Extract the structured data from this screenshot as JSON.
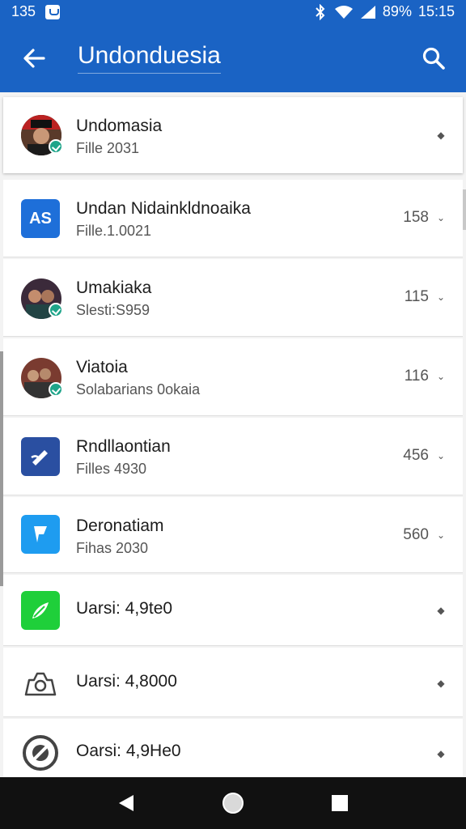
{
  "status_bar": {
    "left_text": "135",
    "battery": "89%",
    "time": "15:15"
  },
  "app_bar": {
    "title": "Undonduesia",
    "back_icon": "arrow-back-icon",
    "search_icon": "search-icon"
  },
  "items": [
    {
      "primary": "Undomasia",
      "secondary": "Fille 2031",
      "count": "",
      "icon": "avatar-person"
    },
    {
      "primary": "Undan Nidainkldnoaika",
      "secondary": "Fille.1.0021",
      "count": "158",
      "icon": "as-app-icon"
    },
    {
      "primary": "Umakiaka",
      "secondary": "Slesti:S959",
      "count": "115",
      "icon": "avatar-couple"
    },
    {
      "primary": "Viatoia",
      "secondary": "Solabarians 0okaia",
      "count": "116",
      "icon": "avatar-group"
    },
    {
      "primary": "Rndllaontian",
      "secondary": "Filles 4930",
      "count": "456",
      "icon": "edit-app-icon"
    },
    {
      "primary": "Deronatiam",
      "secondary": "Fihas 2030",
      "count": "560",
      "icon": "pin-app-icon"
    },
    {
      "primary": "Uarsi: 4,9te0",
      "secondary": "",
      "count": "",
      "icon": "leaf-app-icon"
    },
    {
      "primary": "Uarsi: 4,8000",
      "secondary": "",
      "count": "",
      "icon": "camera-icon"
    },
    {
      "primary": "Oarsi: 4,9He0",
      "secondary": "",
      "count": "",
      "icon": "block-icon"
    }
  ],
  "colors": {
    "primary": "#1a63c4",
    "as_icon": "#1e6fd9",
    "edit_icon": "#2a4fa1",
    "pin_icon": "#1e9cf0",
    "leaf_icon": "#1fcf3a"
  },
  "nav_bar": {
    "back": "nav-back-icon",
    "home": "nav-home-icon",
    "recents": "nav-recents-icon"
  }
}
